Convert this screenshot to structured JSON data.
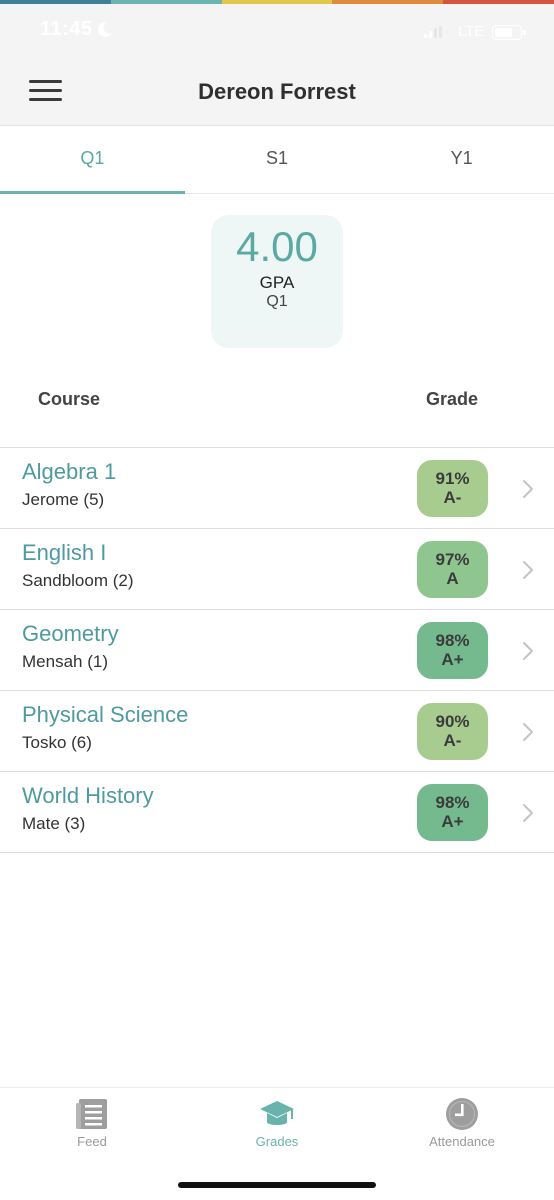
{
  "status_bar": {
    "time": "11:45",
    "network": "LTE"
  },
  "colors": {
    "accent": "#5aa9a3",
    "top_stripe": [
      "#3f7f98",
      "#6bb5ae",
      "#e2c84a",
      "#e08a3c",
      "#d3553f"
    ],
    "grade_a_minus": "#a8cc8f",
    "grade_a": "#8fc690",
    "grade_a_plus": "#74ba8e"
  },
  "header": {
    "title": "Dereon Forrest",
    "menu_icon": "hamburger-icon"
  },
  "tabs": [
    {
      "label": "Q1",
      "active": true
    },
    {
      "label": "S1",
      "active": false
    },
    {
      "label": "Y1",
      "active": false
    }
  ],
  "gpa": {
    "value": "4.00",
    "label": "GPA",
    "period": "Q1"
  },
  "columns": {
    "course": "Course",
    "grade": "Grade"
  },
  "courses": [
    {
      "name": "Algebra 1",
      "teacher": "Jerome (5)",
      "percent": "91%",
      "letter": "A-"
    },
    {
      "name": "English I",
      "teacher": "Sandbloom (2)",
      "percent": "97%",
      "letter": "A"
    },
    {
      "name": "Geometry",
      "teacher": "Mensah (1)",
      "percent": "98%",
      "letter": "A+"
    },
    {
      "name": "Physical Science",
      "teacher": "Tosko (6)",
      "percent": "90%",
      "letter": "A-"
    },
    {
      "name": "World History",
      "teacher": "Mate (3)",
      "percent": "98%",
      "letter": "A+"
    }
  ],
  "tabbar": [
    {
      "label": "Feed",
      "icon": "feed-icon",
      "active": false
    },
    {
      "label": "Grades",
      "icon": "graduation-cap-icon",
      "active": true
    },
    {
      "label": "Attendance",
      "icon": "clock-icon",
      "active": false
    }
  ]
}
